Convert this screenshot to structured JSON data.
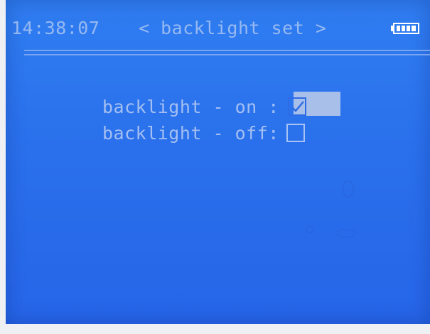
{
  "status": {
    "time": "14:38:07",
    "title": "< backlight set >",
    "battery_icon": "battery-full-icon"
  },
  "options": [
    {
      "label": "backlight - on :",
      "checked": true,
      "selected": true
    },
    {
      "label": "backlight - off:",
      "checked": false,
      "selected": false
    }
  ],
  "colors": {
    "screen": "#2a70ec",
    "text": "#a4bff2",
    "selection": "#a8bfe9"
  }
}
